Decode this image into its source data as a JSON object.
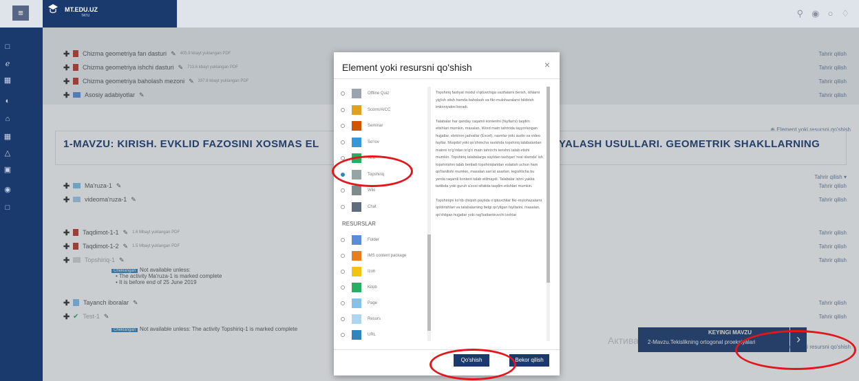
{
  "header": {
    "brand_name": "MT.EDU.UZ",
    "brand_sub": "TATU",
    "menu_icon": "hamburger-icon"
  },
  "sidebar": {
    "icons": [
      "square-icon",
      "chart-icon",
      "grid-icon",
      "gauge-icon",
      "home-icon",
      "calendar-icon",
      "graduation-icon",
      "book-icon",
      "globe-icon",
      "folder-icon"
    ]
  },
  "top_list": [
    {
      "title": "Chizma geometriya fan dasturi",
      "meta": "405.9 kbayt yuklangan PDF",
      "action": "Tahrir qilish"
    },
    {
      "title": "Chizma geometriya ishchi dasturi",
      "meta": "713.6 kbayt yuklangan PDF",
      "action": "Tahrir qilish"
    },
    {
      "title": "Chizma geometriya baholash mezoni",
      "meta": "337.8 kbayt yuklangan PDF",
      "action": "Tahrir qilish"
    },
    {
      "title": "Asosiy adabiyotlar",
      "meta": "",
      "action": "Tahrir qilish"
    }
  ],
  "add_activity_label": "Element yoki resursni qo'shish",
  "section": {
    "title": "1-MAVZU: KIRISH. EVKLID FAZOSINI XOSMAS EL",
    "title_end": "SIYALASH USULLARI. GEOMETRIK SHAKLLARNING",
    "edit_menu": "Tahrir qilish"
  },
  "items": [
    {
      "title": "Ma'ruza-1",
      "meta": "",
      "action": "Tahrir qilish"
    },
    {
      "title": "videoma'ruza-1",
      "meta": "",
      "action": "Tahrir qilish"
    },
    {
      "title": "Taqdimot-1-1",
      "meta": "1.6 Mbayt yuklangan PDF",
      "action": "Tahrir qilish"
    },
    {
      "title": "Taqdimot-1-2",
      "meta": "1.5 Mbayt yuklangan PDF",
      "action": "Tahrir qilish"
    },
    {
      "title": "Topshiriq-1",
      "meta": "",
      "action": "Tahrir qilish"
    },
    {
      "title": "Tayanch iboralar",
      "meta": "",
      "action": "Tahrir qilish"
    },
    {
      "title": "Test-1",
      "meta": "",
      "action": "Tahrir qilish"
    }
  ],
  "restrictions": {
    "badge": "Cheklangan",
    "r1_title": "Not available unless:",
    "r1_line1": "The activity Ma'ruza-1 is marked complete",
    "r1_line2": "It is before end of 25 June 2019",
    "r2": "Not available unless: The activity Topshiriq-1 is marked complete"
  },
  "next_section": {
    "label": "KEYINGI MAVZU",
    "title": "2-Mavzu.Tekislikning ortogonal proeksiyalari"
  },
  "watermark": "Активация Windows",
  "modal": {
    "title": "Element yoki resursni qo'shish",
    "close": "×",
    "activities": [
      {
        "label": "Offline Quiz",
        "icon": "quiz-icon",
        "color": "#9aa3b0"
      },
      {
        "label": "Scorm/AICC",
        "icon": "scorm-icon",
        "color": "#e0a020"
      },
      {
        "label": "Seminar",
        "icon": "seminar-icon",
        "color": "#d35400"
      },
      {
        "label": "So'rov",
        "icon": "survey-icon",
        "color": "#3498db"
      },
      {
        "label": "Test",
        "icon": "test-icon",
        "color": "#27ae60"
      },
      {
        "label": "Topshiriq",
        "icon": "assignment-icon",
        "color": "#95a5a6"
      },
      {
        "label": "Wiki",
        "icon": "wiki-icon",
        "color": "#7f8c8d"
      },
      {
        "label": "Chat",
        "icon": "chat-icon",
        "color": "#5d6d7e"
      }
    ],
    "resources_header": "RESURSLAR",
    "resources": [
      {
        "label": "Folder",
        "icon": "folder-icon",
        "color": "#5a8dd6"
      },
      {
        "label": "IMS content package",
        "icon": "package-icon",
        "color": "#e67e22"
      },
      {
        "label": "Izoh",
        "icon": "label-icon",
        "color": "#f1c40f"
      },
      {
        "label": "Kitob",
        "icon": "book-icon",
        "color": "#27ae60"
      },
      {
        "label": "Page",
        "icon": "page-icon",
        "color": "#85c1e9"
      },
      {
        "label": "Resurs",
        "icon": "file-icon",
        "color": "#aed6f1"
      },
      {
        "label": "URL",
        "icon": "url-icon",
        "color": "#2e86c1"
      }
    ],
    "description_1": "Topshiriq faoliyat modul o'qituvchiga vazifalarni berish, ishlarni yig'ish stish hamda baholash va fikr-mulohazalarni bildirish imkoniyatini beradi.",
    "description_2": "Talabalar har qanday raqamli kontentni (fayllarni) taqdim etishlari mumkin, masalan, Word matn tahririda tayyorlangan hujjatlar, elektron jadvallar (Excel), rasmlar yoki audio va video fayllar. Muqobil yoki qo'shimcha ravishda topshiriq talabalardan matnni to'g'ridan to'g'ri matn tahrirchi terishni talab etishi mumkin. Topshiriq talabalarga saytdan tashqari 'real olamda' ish topshirishni talab beriladi topshiriqlaridan eslatish uchun ham qo'llanilishi mumkin, masalan san'at asarlari, tegishlicha bu yerda raqamli kontent talab etilmaydi. Talabalar ishni yakka tartibda yoki guruh a'zosi sifatida taqdim etishlari mumkin.",
    "description_3": "Topshiriqni ko'rib chiqish paytida o'qituvchilar fikr-mulohazalarni qoldirishlari va talabalarning belgi qo'yilgan fayllarini, masalan, qo'shilgan hujjatlar yoki rag'batlantiruvchi izohlar",
    "add_button": "Qo'shish",
    "cancel_button": "Bekor qilish"
  }
}
